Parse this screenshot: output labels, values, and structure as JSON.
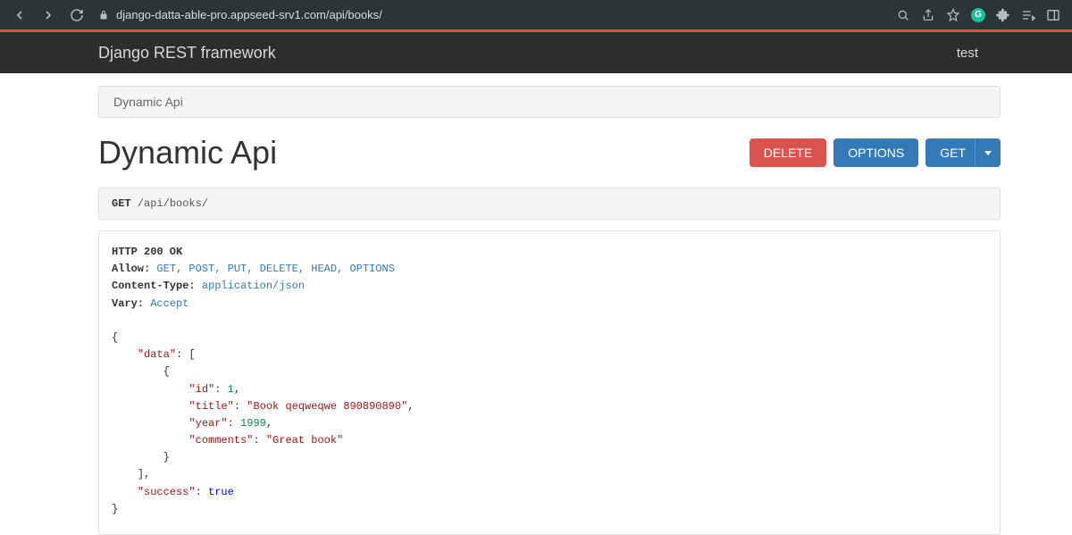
{
  "browser": {
    "url": "django-datta-able-pro.appseed-srv1.com/api/books/"
  },
  "nav": {
    "brand": "Django REST framework",
    "user": "test"
  },
  "breadcrumb": "Dynamic Api",
  "page_title": "Dynamic Api",
  "buttons": {
    "delete": "DELETE",
    "options": "OPTIONS",
    "get": "GET"
  },
  "request": {
    "method": "GET",
    "path": "/api/books/"
  },
  "response": {
    "status_line": "HTTP 200 OK",
    "headers": {
      "allow_label": "Allow:",
      "allow_value": "GET, POST, PUT, DELETE, HEAD, OPTIONS",
      "ctype_label": "Content-Type:",
      "ctype_value": "application/json",
      "vary_label": "Vary:",
      "vary_value": "Accept"
    },
    "body": {
      "data_key": "\"data\"",
      "id_key": "\"id\"",
      "id_val": "1",
      "title_key": "\"title\"",
      "title_val": "\"Book qeqweqwe 890890890\"",
      "year_key": "\"year\"",
      "year_val": "1999",
      "comments_key": "\"comments\"",
      "comments_val": "\"Great book\"",
      "success_key": "\"success\"",
      "success_val": "true"
    }
  }
}
